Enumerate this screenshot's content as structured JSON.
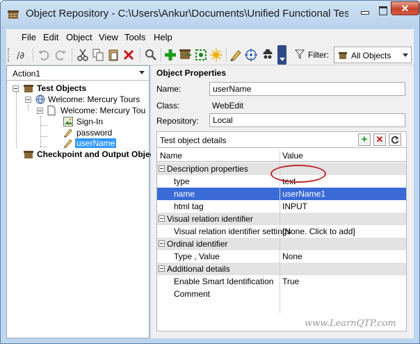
{
  "window": {
    "title": "Object Repository - C:\\Users\\Ankur\\Documents\\Unified Functional Tes",
    "close_label": "✕"
  },
  "menu": [
    {
      "label": "File"
    },
    {
      "label": "Edit"
    },
    {
      "label": "Object"
    },
    {
      "label": "View"
    },
    {
      "label": "Tools"
    },
    {
      "label": "Help"
    }
  ],
  "toolbar": {
    "filter_label": "Filter:",
    "filter_value": "All Objects"
  },
  "left_panel": {
    "action_selected": "Action1",
    "tree": [
      {
        "label": "Test Objects",
        "icon": "folder-icon",
        "level": 0,
        "bold": true
      },
      {
        "label": "Welcome: Mercury Tours",
        "icon": "browser-icon",
        "level": 1
      },
      {
        "label": "Welcome: Mercury Tou",
        "icon": "page-icon",
        "level": 2
      },
      {
        "label": "Sign-In",
        "icon": "image-icon",
        "level": 3
      },
      {
        "label": "password",
        "icon": "edit-icon",
        "level": 3
      },
      {
        "label": "userName",
        "icon": "edit-icon",
        "level": 3,
        "selected": true
      },
      {
        "label": "Checkpoint and Output Objec",
        "icon": "folder-icon",
        "level": 0,
        "bold": true
      }
    ]
  },
  "object_properties": {
    "heading": "Object Properties",
    "name_label": "Name:",
    "name_value": "userName",
    "class_label": "Class:",
    "class_value": "WebEdit",
    "repository_label": "Repository:",
    "repository_value": "Local"
  },
  "details": {
    "header": "Test object details",
    "add_label": "+",
    "remove_label": "✕",
    "col_name": "Name",
    "col_value": "Value",
    "rows": [
      {
        "type": "category",
        "name": "Description properties"
      },
      {
        "type": "prop",
        "name": "type",
        "value": "text"
      },
      {
        "type": "prop",
        "name": "name",
        "value": "userName1",
        "selected": true
      },
      {
        "type": "prop",
        "name": "html tag",
        "value": "INPUT"
      },
      {
        "type": "category",
        "name": "Visual relation identifier"
      },
      {
        "type": "prop",
        "name": "Visual relation identifier settings",
        "value": "[None. Click to add]"
      },
      {
        "type": "category",
        "name": "Ordinal identifier"
      },
      {
        "type": "prop",
        "name": "Type , Value",
        "value": "None"
      },
      {
        "type": "category",
        "name": "Additional details"
      },
      {
        "type": "prop",
        "name": "Enable Smart Identification",
        "value": "True"
      },
      {
        "type": "prop",
        "name": "Comment",
        "value": ""
      }
    ]
  },
  "watermark": "www.LearnQTP.com"
}
